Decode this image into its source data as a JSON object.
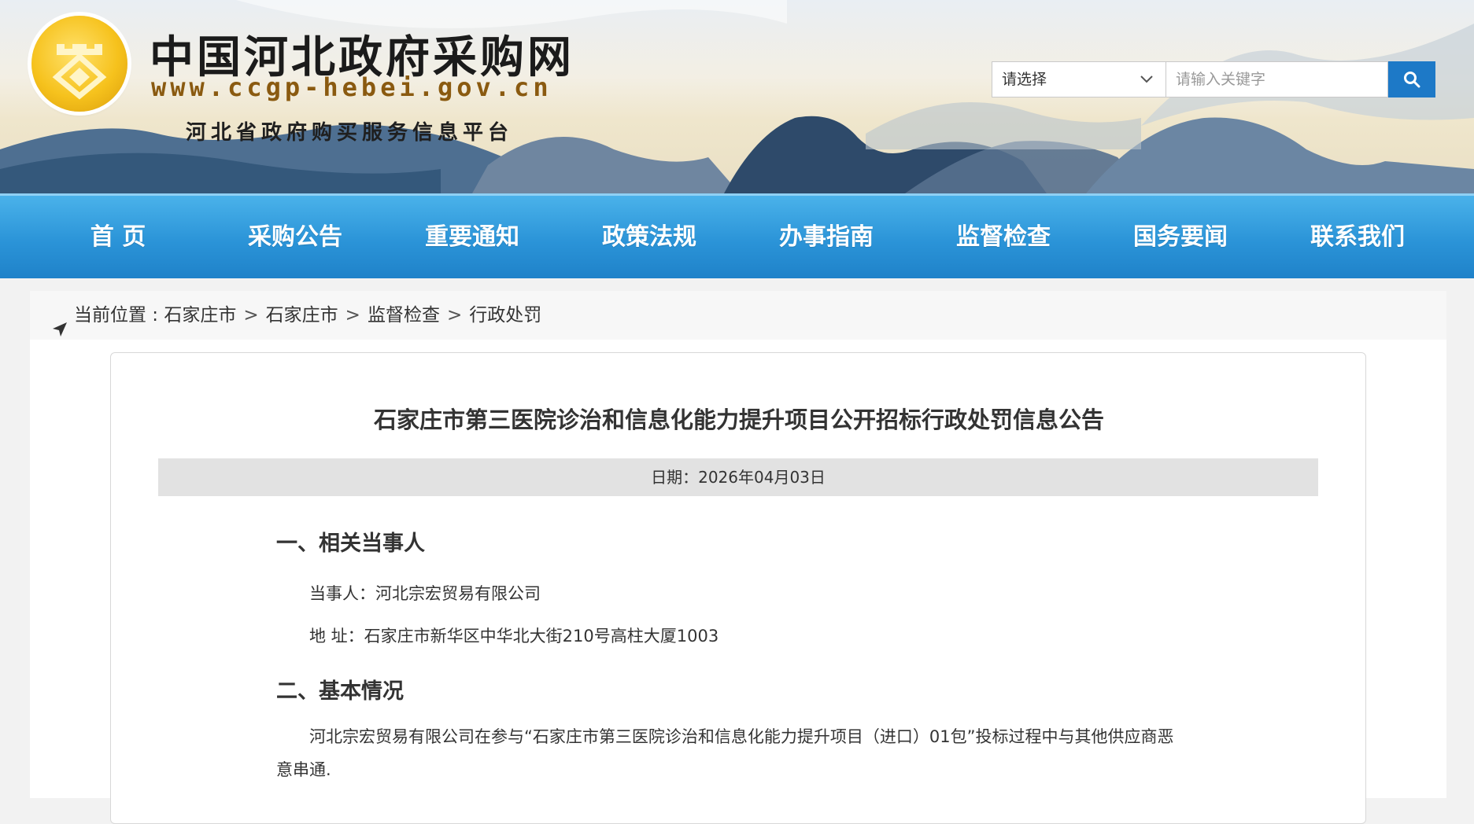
{
  "header": {
    "site_title": "中国河北政府采购网",
    "site_url": "www.ccgp-hebei.gov.cn",
    "site_subtitle": "河北省政府购买服务信息平台",
    "search": {
      "select_value": "请选择",
      "input_placeholder": "请输入关键字",
      "button_icon": "search-icon"
    }
  },
  "nav": {
    "items": [
      {
        "label": "首 页"
      },
      {
        "label": "采购公告"
      },
      {
        "label": "重要通知"
      },
      {
        "label": "政策法规"
      },
      {
        "label": "办事指南"
      },
      {
        "label": "监督检查"
      },
      {
        "label": "国务要闻"
      },
      {
        "label": "联系我们"
      }
    ]
  },
  "breadcrumb": {
    "icon": "location-arrow-icon",
    "prefix": "当前位置 :",
    "items": [
      "石家庄市",
      "石家庄市",
      "监督检查",
      "行政处罚"
    ]
  },
  "article": {
    "title": "石家庄市第三医院诊治和信息化能力提升项目公开招标行政处罚信息公告",
    "date": "日期：2026年04月03日",
    "section1": {
      "heading": "一、相关当事人",
      "party": "当事人：河北宗宏贸易有限公司",
      "address": "地 址：石家庄市新华区中华北大街210号高柱大厦1003"
    },
    "section2": {
      "heading": "二、基本情况",
      "para_line1": "河北宗宏贸易有限公司在参与“石家庄市第三医院诊治和信息化能力提升项目（进口）01包”投标过程中与其他供应商恶",
      "para_line2": "意串通."
    }
  },
  "colors": {
    "nav_blue": "#2b94d8",
    "search_button": "#1d79c7",
    "logo_gold": "#f6c21d"
  }
}
